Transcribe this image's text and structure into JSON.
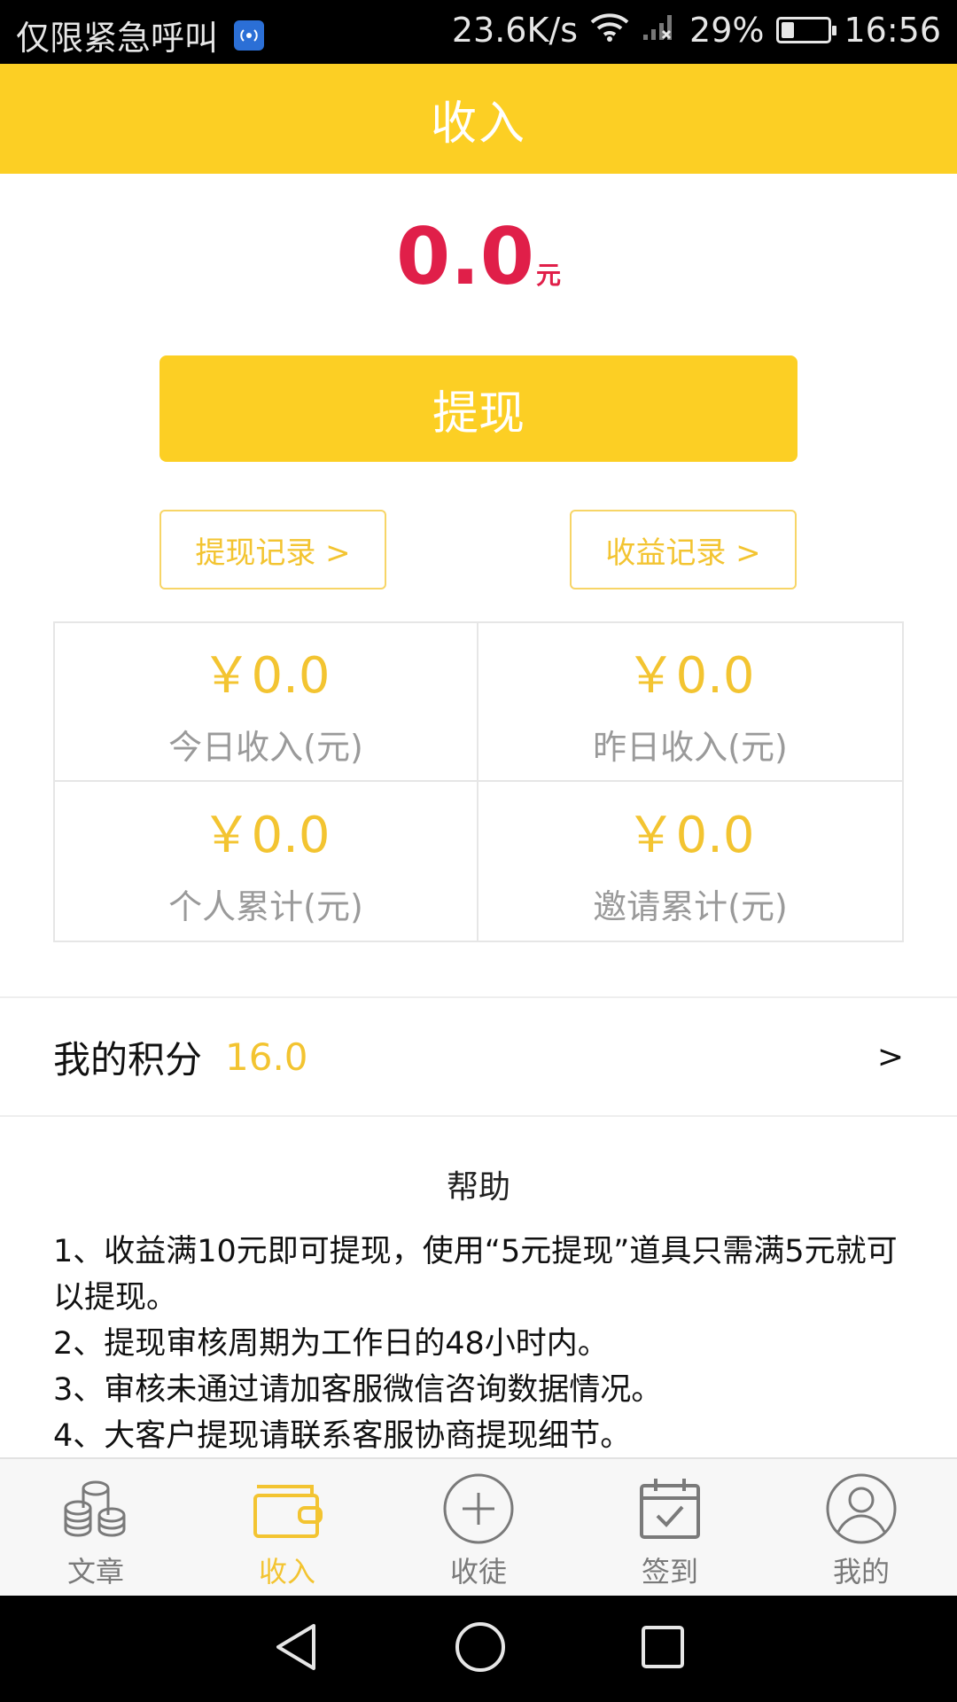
{
  "status_bar": {
    "carrier_text": "仅限紧急呼叫",
    "net_speed": "23.6K/s",
    "battery_percent": "29%",
    "battery_level": 0.29,
    "time": "16:56",
    "icons": [
      "sim-badge-icon",
      "wifi-icon",
      "signal-icon",
      "battery-icon"
    ]
  },
  "header": {
    "title": "收入"
  },
  "balance": {
    "amount": "0.0",
    "unit": "元"
  },
  "actions": {
    "withdraw_label": "提现",
    "withdraw_records_label": "提现记录 >",
    "earnings_records_label": "收益记录 >"
  },
  "stats": [
    {
      "value": "￥0.0",
      "label": "今日收入(元)"
    },
    {
      "value": "￥0.0",
      "label": "昨日收入(元)"
    },
    {
      "value": "￥0.0",
      "label": "个人累计(元)"
    },
    {
      "value": "￥0.0",
      "label": "邀请累计(元)"
    }
  ],
  "points": {
    "label": "我的积分",
    "value": "16.0",
    "arrow": ">"
  },
  "help": {
    "title": "帮助",
    "items": [
      "1、收益满10元即可提现，使用“5元提现”道具只需满5元就可以提现。",
      "2、提现审核周期为工作日的48小时内。",
      "3、审核未通过请加客服微信咨询数据情况。",
      "4、大客户提现请联系客服协商提现细节。"
    ]
  },
  "tabs": [
    {
      "label": "文章",
      "icon": "coins-icon",
      "active": false
    },
    {
      "label": "收入",
      "icon": "wallet-icon",
      "active": true
    },
    {
      "label": "收徒",
      "icon": "plus-circle-icon",
      "active": false
    },
    {
      "label": "签到",
      "icon": "calendar-check-icon",
      "active": false
    },
    {
      "label": "我的",
      "icon": "user-icon",
      "active": false
    }
  ],
  "colors": {
    "primary_yellow": "#fccf24",
    "accent_red": "#e01f49",
    "text_yellow": "#f3c431"
  }
}
